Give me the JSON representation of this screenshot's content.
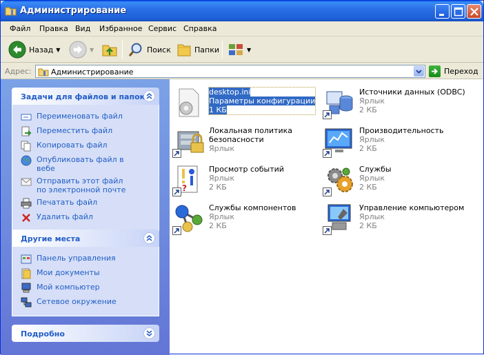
{
  "window": {
    "title": "Администрирование"
  },
  "menu": [
    "Файл",
    "Правка",
    "Вид",
    "Избранное",
    "Сервис",
    "Справка"
  ],
  "toolbar": {
    "back": "Назад",
    "search": "Поиск",
    "folders": "Папки"
  },
  "address": {
    "label": "Адрес:",
    "value": "Администрирование",
    "go": "Переход"
  },
  "tasks_panel": {
    "title": "Задачи для файлов и папок",
    "items": [
      {
        "label": "Переименовать файл",
        "icon": "rename-icon"
      },
      {
        "label": "Переместить файл",
        "icon": "move-icon"
      },
      {
        "label": "Копировать файл",
        "icon": "copy-icon"
      },
      {
        "label": "Опубликовать файл в вебе",
        "icon": "web-publish-icon"
      },
      {
        "label": "Отправить этот файл по электронной почте",
        "icon": "email-icon"
      },
      {
        "label": "Печатать файл",
        "icon": "printer-icon"
      },
      {
        "label": "Удалить файл",
        "icon": "delete-icon"
      }
    ]
  },
  "places_panel": {
    "title": "Другие места",
    "items": [
      {
        "label": "Панель управления",
        "icon": "control-panel-icon"
      },
      {
        "label": "Мои документы",
        "icon": "my-documents-icon"
      },
      {
        "label": "Мой компьютер",
        "icon": "my-computer-icon"
      },
      {
        "label": "Сетевое окружение",
        "icon": "network-icon"
      }
    ]
  },
  "details_panel": {
    "title": "Подробно"
  },
  "files": [
    {
      "name": "desktop.ini",
      "line2": "Параметры конфигурации",
      "line3": "1 КБ",
      "icon": "ini-file-icon",
      "selected": true
    },
    {
      "name": "Источники данных (ODBC)",
      "line2": "Ярлык",
      "line3": "2 КБ",
      "icon": "odbc-icon"
    },
    {
      "name": "Локальная политика",
      "name2": "безопасности",
      "line2": "Ярлык",
      "icon": "security-policy-icon"
    },
    {
      "name": "Производительность",
      "line2": "Ярлык",
      "line3": "2 КБ",
      "icon": "performance-icon"
    },
    {
      "name": "Просмотр событий",
      "line2": "Ярлык",
      "line3": "2 КБ",
      "icon": "event-viewer-icon"
    },
    {
      "name": "Службы",
      "line2": "Ярлык",
      "line3": "2 КБ",
      "icon": "services-icon"
    },
    {
      "name": "Службы компонентов",
      "line2": "Ярлык",
      "line3": "2 КБ",
      "icon": "component-services-icon"
    },
    {
      "name": "Управление компьютером",
      "line2": "Ярлык",
      "line3": "2 КБ",
      "icon": "computer-management-icon"
    }
  ]
}
